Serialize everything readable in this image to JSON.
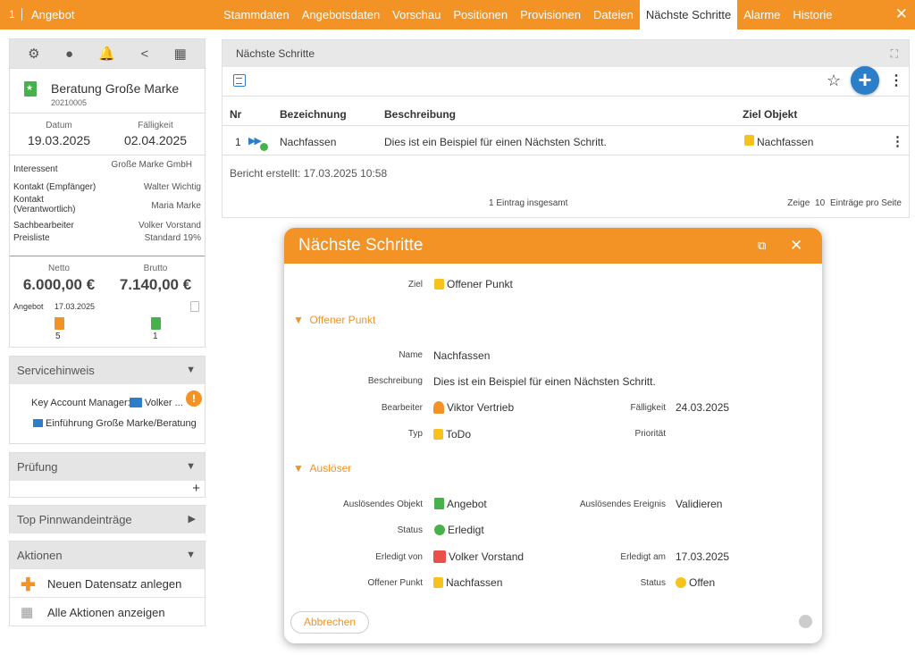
{
  "topbar": {
    "number": "1",
    "title": "Angebot",
    "tabs": [
      "Stammdaten",
      "Angebotsdaten",
      "Vorschau",
      "Positionen",
      "Provisionen",
      "Dateien",
      "Nächste Schritte",
      "Alarme",
      "Historie"
    ],
    "active_tab": "Nächste Schritte",
    "close": "✕"
  },
  "record": {
    "title": "Beratung Große Marke",
    "number": "20210005",
    "datum_label": "Datum",
    "datum": "19.03.2025",
    "faelligkeit_label": "Fälligkeit",
    "faelligkeit": "02.04.2025",
    "fields": [
      {
        "label": "Interessent",
        "value": "Große Marke GmbH"
      },
      {
        "label": "Kontakt (Empfänger)",
        "value": "Walter Wichtig"
      },
      {
        "label": "Kontakt (Verantwortlich)",
        "value": "Maria Marke"
      },
      {
        "label": "Sachbearbeiter",
        "value": "Volker Vorstand"
      },
      {
        "label": "Preisliste",
        "value": "Standard 19%"
      }
    ],
    "netto_label": "Netto",
    "netto": "6.000,00 €",
    "brutto_label": "Brutto",
    "brutto": "7.140,00 €",
    "angebot_label": "Angebot",
    "angebot_date": "17.03.2025",
    "count_orange": "5",
    "count_green": "1"
  },
  "panels": {
    "servicehinweis": {
      "title": "Servicehinweis",
      "key_account_label": "Key Account Manager:",
      "key_account_value": "Volker ...",
      "link": "Einführung Große Marke/Beratung"
    },
    "pruefung": {
      "title": "Prüfung",
      "add": "+"
    },
    "pinnwand": {
      "title": "Top Pinnwandeinträge"
    },
    "aktionen": {
      "title": "Aktionen",
      "items": [
        "Neuen Datensatz anlegen",
        "Alle Aktionen anzeigen"
      ]
    }
  },
  "main": {
    "title": "Nächste Schritte",
    "columns": [
      "Nr",
      "Bezeichnung",
      "Beschreibung",
      "Ziel Objekt"
    ],
    "rows": [
      {
        "nr": "1",
        "bezeichnung": "Nachfassen",
        "beschreibung": "Dies ist ein Beispiel für einen Nächsten Schritt.",
        "ziel": "Nachfassen"
      }
    ],
    "report": "Bericht erstellt: 17.03.2025 10:58",
    "total": "1 Eintrag insgesamt",
    "show_label": "Zeige",
    "page_size": "10",
    "per_page_label": "Einträge pro Seite"
  },
  "dialog": {
    "title": "Nächste Schritte",
    "ziel_label": "Ziel",
    "ziel_value": "Offener Punkt",
    "section1": "Offener Punkt",
    "name_label": "Name",
    "name_value": "Nachfassen",
    "beschreibung_label": "Beschreibung",
    "beschreibung_value": "Dies ist ein Beispiel für einen Nächsten Schritt.",
    "bearbeiter_label": "Bearbeiter",
    "bearbeiter_value": "Viktor Vertrieb",
    "faelligkeit_label": "Fälligkeit",
    "faelligkeit_value": "24.03.2025",
    "typ_label": "Typ",
    "typ_value": "ToDo",
    "prioritaet_label": "Priorität",
    "section2": "Auslöser",
    "obj_label": "Auslösendes Objekt",
    "obj_value": "Angebot",
    "event_label": "Auslösendes Ereignis",
    "event_value": "Validieren",
    "status_label": "Status",
    "status_value": "Erledigt",
    "erledigt_von_label": "Erledigt von",
    "erledigt_von_value": "Volker Vorstand",
    "erledigt_am_label": "Erledigt am",
    "erledigt_am_value": "17.03.2025",
    "offener_punkt_label": "Offener Punkt",
    "offener_punkt_value": "Nachfassen",
    "status2_label": "Status",
    "status2_value": "Offen",
    "cancel": "Abbrechen"
  },
  "colors": {
    "accent": "#f39325",
    "blue": "#2a7fc8",
    "green": "#47b24b"
  }
}
